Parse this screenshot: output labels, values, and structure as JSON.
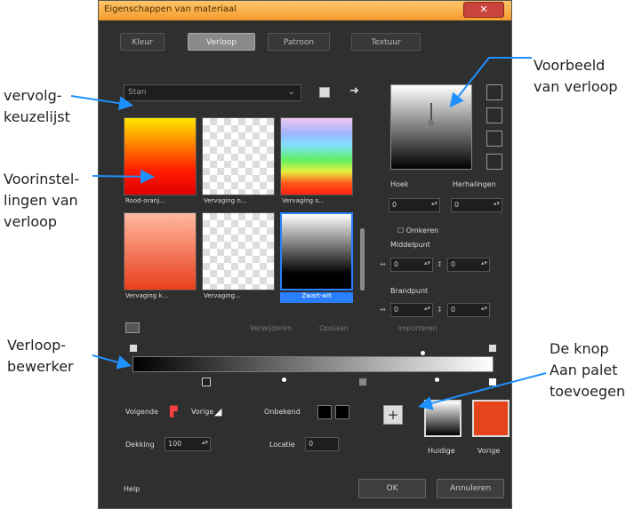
{
  "window": {
    "title": "Eigenschappen van materiaal",
    "close_label": "✕"
  },
  "tabs": [
    {
      "label": "Kleur",
      "active": false
    },
    {
      "label": "Verloop",
      "active": true
    },
    {
      "label": "Patroon",
      "active": false
    },
    {
      "label": "Textuur",
      "active": false
    }
  ],
  "dropdown": {
    "value": "Stan"
  },
  "presets": [
    {
      "caption": "Rood-oranj...",
      "fill": "red-yellow"
    },
    {
      "caption": "Vervaging n...",
      "fill": "transparent"
    },
    {
      "caption": "Vervaging s...",
      "fill": "rainbow"
    },
    {
      "caption": "Vervaging k...",
      "fill": "orange-checker"
    },
    {
      "caption": "Vervaging...",
      "fill": "white-checker"
    },
    {
      "caption": "Zwart-wit",
      "fill": "white-black",
      "selected": true
    }
  ],
  "angle": {
    "label": "Hoek",
    "value": "0"
  },
  "repeats": {
    "label": "Herhalingen",
    "value": "0"
  },
  "repeat_check": "Omkeren",
  "center": {
    "label": "Middelpunt",
    "h": "0",
    "v": "0"
  },
  "focus": {
    "label": "Brandpunt",
    "h": "0",
    "v": "0"
  },
  "mid_buttons": [
    "Verwijderen",
    "Opslaan",
    "Importeren"
  ],
  "editor": {
    "location_label": "Locatie",
    "location_value": "0",
    "opacity_label": "Dekking",
    "opacity_value": "100"
  },
  "stops": {
    "previous_label": "Volgende",
    "next_label": "Vorige",
    "unknown_label": "Onbekend"
  },
  "swatches": {
    "current": "Huidige",
    "previous": "Vorige",
    "current_color": "#111111",
    "previous_color": "#e8441c"
  },
  "footer": {
    "help": "Help",
    "ok": "OK",
    "cancel": "Annuleren"
  },
  "annotations": {
    "dropdown_line1": "vervolg-",
    "dropdown_line2": "keuzelijst",
    "presets_line1": "Voorinstel-",
    "presets_line2": "lingen van",
    "presets_line3": "verloop",
    "editor_line1": "Verloop-",
    "editor_line2": "bewerker",
    "preview_line1": "Voorbeeld",
    "preview_line2": "van verloop",
    "palette_line1": "De knop",
    "palette_line2": "Aan palet",
    "palette_line3": "toevoegen"
  },
  "accent_color": "#1e90ff"
}
